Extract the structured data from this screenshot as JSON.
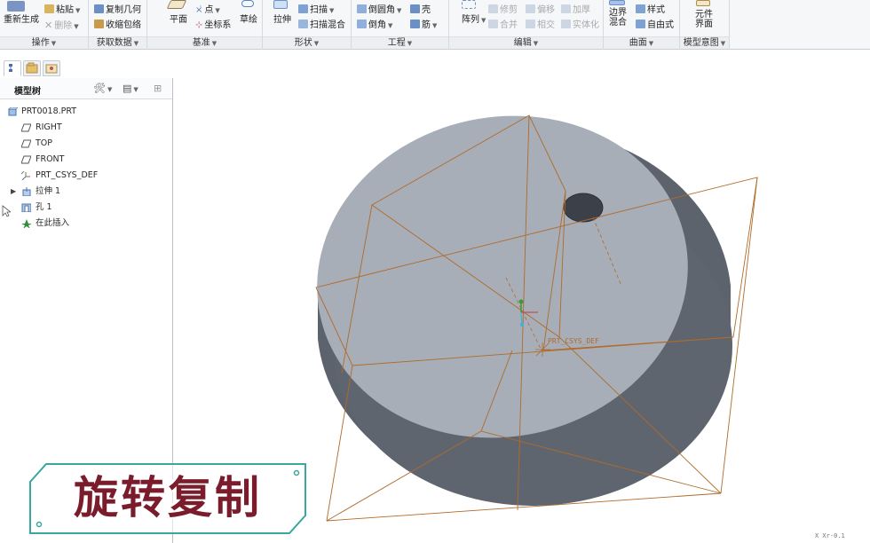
{
  "ribbon": {
    "groups": [
      {
        "label": "操作"
      },
      {
        "label": "获取数据"
      },
      {
        "label": "基准"
      },
      {
        "label": "形状"
      },
      {
        "label": "工程"
      },
      {
        "label": "编辑"
      },
      {
        "label": "曲面"
      },
      {
        "label": "模型意图"
      }
    ],
    "operation": {
      "regenerate": "重新生成",
      "paste": "粘贴",
      "delete": "删除"
    },
    "get_data": {
      "copy_geometry": "复制几何",
      "shrinkwrap": "收缩包络"
    },
    "datum": {
      "plane": "平面",
      "point": "点",
      "csys": "坐标系",
      "sketch": "草绘"
    },
    "shapes": {
      "extrude": "拉伸",
      "sweep": "扫描",
      "swept_blend": "扫描混合"
    },
    "engineering": {
      "round": "倒圆角",
      "chamfer": "倒角",
      "shell": "壳",
      "rib": "筋"
    },
    "editing": {
      "pattern": "阵列",
      "trim": "修剪",
      "offset": "偏移",
      "thicken": "加厚",
      "merge": "合并",
      "intersect": "相交",
      "solidify": "实体化"
    },
    "surfaces": {
      "boundary_blend_1": "边界",
      "boundary_blend_2": "混合",
      "style": "样式",
      "freestyle": "自由式"
    },
    "model_intent": {
      "component_interface_1": "元件",
      "component_interface_2": "界面"
    }
  },
  "model_tree": {
    "title": "模型树",
    "items": [
      {
        "label": "PRT0018.PRT",
        "icon": "part-icon"
      },
      {
        "label": "RIGHT",
        "icon": "datum-plane-icon"
      },
      {
        "label": "TOP",
        "icon": "datum-plane-icon"
      },
      {
        "label": "FRONT",
        "icon": "datum-plane-icon"
      },
      {
        "label": "PRT_CSYS_DEF",
        "icon": "csys-icon"
      },
      {
        "label": "拉伸 1",
        "icon": "extrude-icon",
        "expandable": true
      },
      {
        "label": "孔 1",
        "icon": "hole-icon"
      },
      {
        "label": "在此插入",
        "icon": "insert-here-icon"
      }
    ]
  },
  "viewport": {
    "csys_label": "PRT_CSYS_DEF",
    "overlay_caption": "旋转复制",
    "status": "X Xr-0.1"
  },
  "colors": {
    "cylinder_top": "#a8aeb8",
    "cylinder_side": "#5d636d",
    "datum_plane": "#b06a2a",
    "caption_text": "#7a1c2c",
    "caption_frame": "#3aa6a0"
  }
}
